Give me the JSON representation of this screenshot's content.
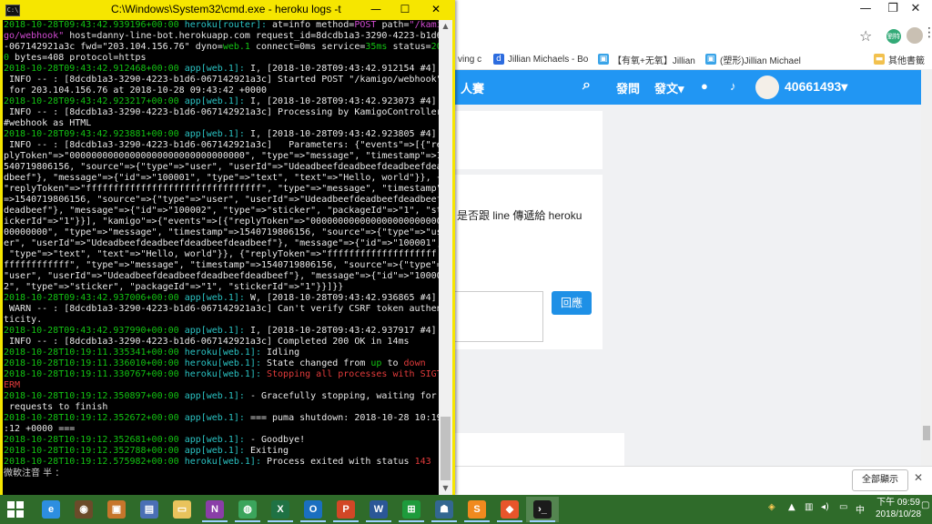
{
  "browser": {
    "bookmarks": [
      {
        "label": "ving c",
        "icon": "generic-page-icon",
        "color": "#888888"
      },
      {
        "label": "Jillian Michaels - Bo",
        "icon": "d-site-icon",
        "color": "#2d6cdf"
      },
      {
        "label": "【有氧+无氧】Jillian",
        "icon": "bilibili-icon",
        "color": "#3aa4e8"
      },
      {
        "label": "(塑形)Jillian Michael",
        "icon": "bilibili-icon",
        "color": "#3aa4e8"
      },
      {
        "label": "其他書籤",
        "icon": "folder-icon",
        "color": "#f2c14e"
      }
    ],
    "ext_badge": "劉特",
    "site": {
      "nav_partial": "人賽",
      "nav_items": [
        "發問",
        "發文"
      ],
      "nav_caret": "▾",
      "username": "40661493",
      "user_caret": "▾",
      "answer_text": "是否跟 line 傳遞給 heroku",
      "reply_button": "回應",
      "show_all": "全部顯示"
    }
  },
  "cmd": {
    "title": "C:\\Windows\\System32\\cmd.exe - heroku  logs -t",
    "lines": [
      [
        [
          "2018-10-28T09:43:42.939196+00:00 ",
          "g"
        ],
        [
          "heroku[router]: ",
          "c"
        ],
        [
          "at=info method=",
          "w"
        ],
        [
          "POST",
          "m"
        ],
        [
          " path=",
          "w"
        ],
        [
          "\"/kami",
          "m"
        ]
      ],
      [
        [
          "go/webhook\"",
          "m"
        ],
        [
          " host=danny-line-bot.herokuapp.com request_id=8dcdb1a3-3290-4223-b1d6",
          "w"
        ]
      ],
      [
        [
          "-067142921a3c fwd=\"203.104.156.76\" dyno=",
          "w"
        ],
        [
          "web.1",
          "g"
        ],
        [
          " connect=0ms service=",
          "w"
        ],
        [
          "35ms",
          "g"
        ],
        [
          " status=",
          "w"
        ],
        [
          "20",
          "g"
        ]
      ],
      [
        [
          "0",
          "g"
        ],
        [
          " bytes=408 protocol=https",
          "w"
        ]
      ],
      [
        [
          "2018-10-28T09:43:42.912468+00:00 ",
          "g"
        ],
        [
          "app[web.1]: ",
          "c"
        ],
        [
          "I, [2018-10-28T09:43:42.912154 #4]",
          "w"
        ]
      ],
      [
        [
          " INFO -- : [8dcdb1a3-3290-4223-b1d6-067142921a3c] Started POST \"/kamigo/webhook\"",
          "w"
        ]
      ],
      [
        [
          " for 203.104.156.76 at 2018-10-28 09:43:42 +0000",
          "w"
        ]
      ],
      [
        [
          "2018-10-28T09:43:42.923217+00:00 ",
          "g"
        ],
        [
          "app[web.1]: ",
          "c"
        ],
        [
          "I, [2018-10-28T09:43:42.923073 #4]",
          "w"
        ]
      ],
      [
        [
          " INFO -- : [8dcdb1a3-3290-4223-b1d6-067142921a3c] Processing by KamigoController",
          "w"
        ]
      ],
      [
        [
          "#webhook as HTML",
          "w"
        ]
      ],
      [
        [
          "2018-10-28T09:43:42.923881+00:00 ",
          "g"
        ],
        [
          "app[web.1]: ",
          "c"
        ],
        [
          "I, [2018-10-28T09:43:42.923805 #4]",
          "w"
        ]
      ],
      [
        [
          " INFO -- : [8dcdb1a3-3290-4223-b1d6-067142921a3c]   Parameters: {\"events\"=>[{\"re",
          "w"
        ]
      ],
      [
        [
          "plyToken\"=>\"00000000000000000000000000000000\", \"type\"=>\"message\", \"timestamp\"=>1",
          "w"
        ]
      ],
      [
        [
          "540719806156, \"source\"=>{\"type\"=>\"user\", \"userId\"=>\"Udeadbeefdeadbeefdeadbeefdea",
          "w"
        ]
      ],
      [
        [
          "dbeef\"}, \"message\"=>{\"id\"=>\"100001\", \"type\"=>\"text\", \"text\"=>\"Hello, world\"}}, {",
          "w"
        ]
      ],
      [
        [
          "\"replyToken\"=>\"ffffffffffffffffffffffffffffffff\", \"type\"=>\"message\", \"timestamp\"",
          "w"
        ]
      ],
      [
        [
          "=>1540719806156, \"source\"=>{\"type\"=>\"user\", \"userId\"=>\"Udeadbeefdeadbeefdeadbeef",
          "w"
        ]
      ],
      [
        [
          "deadbeef\"}, \"message\"=>{\"id\"=>\"100002\", \"type\"=>\"sticker\", \"packageId\"=>\"1\", \"st",
          "w"
        ]
      ],
      [
        [
          "ickerId\"=>\"1\"}}], \"kamigo\"=>{\"events\"=>[{\"replyToken\"=>\"000000000000000000000000",
          "w"
        ]
      ],
      [
        [
          "00000000\", \"type\"=>\"message\", \"timestamp\"=>1540719806156, \"source\"=>{\"type\"=>\"us",
          "w"
        ]
      ],
      [
        [
          "er\", \"userId\"=>\"Udeadbeefdeadbeefdeadbeefdeadbeef\"}, \"message\"=>{\"id\"=>\"100001\",",
          "w"
        ]
      ],
      [
        [
          " \"type\"=>\"text\", \"text\"=>\"Hello, world\"}}, {\"replyToken\"=>\"ffffffffffffffffffff",
          "w"
        ]
      ],
      [
        [
          "ffffffffffff\", \"type\"=>\"message\", \"timestamp\"=>1540719806156, \"source\"=>{\"type\"=>",
          "w"
        ]
      ],
      [
        [
          "\"user\", \"userId\"=>\"Udeadbeefdeadbeefdeadbeefdeadbeef\"}, \"message\"=>{\"id\"=>\"10000",
          "w"
        ]
      ],
      [
        [
          "2\", \"type\"=>\"sticker\", \"packageId\"=>\"1\", \"stickerId\"=>\"1\"}}]}}",
          "w"
        ]
      ],
      [
        [
          "2018-10-28T09:43:42.937006+00:00 ",
          "g"
        ],
        [
          "app[web.1]: ",
          "c"
        ],
        [
          "W, [2018-10-28T09:43:42.936865 #4]",
          "w"
        ]
      ],
      [
        [
          " WARN -- : [8dcdb1a3-3290-4223-b1d6-067142921a3c] Can't verify CSRF token authen",
          "w"
        ]
      ],
      [
        [
          "ticity.",
          "w"
        ]
      ],
      [
        [
          "2018-10-28T09:43:42.937990+00:00 ",
          "g"
        ],
        [
          "app[web.1]: ",
          "c"
        ],
        [
          "I, [2018-10-28T09:43:42.937917 #4]",
          "w"
        ]
      ],
      [
        [
          " INFO -- : [8dcdb1a3-3290-4223-b1d6-067142921a3c] Completed 200 OK in 14ms",
          "w"
        ]
      ],
      [
        [
          "2018-10-28T10:19:11.335341+00:00 ",
          "g"
        ],
        [
          "heroku[web.1]: ",
          "c"
        ],
        [
          "Idling",
          "w"
        ]
      ],
      [
        [
          "2018-10-28T10:19:11.336010+00:00 ",
          "g"
        ],
        [
          "heroku[web.1]: ",
          "c"
        ],
        [
          "State changed from ",
          "w"
        ],
        [
          "up",
          "g"
        ],
        [
          " to ",
          "w"
        ],
        [
          "down",
          "r"
        ]
      ],
      [
        [
          "2018-10-28T10:19:11.330767+00:00 ",
          "g"
        ],
        [
          "heroku[web.1]: ",
          "c"
        ],
        [
          "Stopping all processes with SIGT",
          "r"
        ]
      ],
      [
        [
          "ERM",
          "r"
        ]
      ],
      [
        [
          "2018-10-28T10:19:12.350897+00:00 ",
          "g"
        ],
        [
          "app[web.1]: ",
          "c"
        ],
        [
          "- Gracefully stopping, waiting for",
          "w"
        ]
      ],
      [
        [
          " requests to finish",
          "w"
        ]
      ],
      [
        [
          "2018-10-28T10:19:12.352672+00:00 ",
          "g"
        ],
        [
          "app[web.1]: ",
          "c"
        ],
        [
          "=== puma shutdown: 2018-10-28 10:19",
          "w"
        ]
      ],
      [
        [
          ":12 +0000 ===",
          "w"
        ]
      ],
      [
        [
          "2018-10-28T10:19:12.352681+00:00 ",
          "g"
        ],
        [
          "app[web.1]: ",
          "c"
        ],
        [
          "- Goodbye!",
          "w"
        ]
      ],
      [
        [
          "2018-10-28T10:19:12.352788+00:00 ",
          "g"
        ],
        [
          "app[web.1]: ",
          "c"
        ],
        [
          "Exiting",
          "w"
        ]
      ],
      [
        [
          "2018-10-28T10:19:12.575982+00:00 ",
          "g"
        ],
        [
          "heroku[web.1]: ",
          "c"
        ],
        [
          "Process exited with status ",
          "w"
        ],
        [
          "143",
          "r"
        ]
      ]
    ],
    "ime_status": "微軟注音 半 ："
  },
  "taskbar": {
    "apps": [
      {
        "name": "ie-icon",
        "glyph": "e",
        "color": "#2d8ee0"
      },
      {
        "name": "media-player-icon",
        "glyph": "◉",
        "color": "#6b4b2a"
      },
      {
        "name": "game-icon",
        "glyph": "▣",
        "color": "#c7762b"
      },
      {
        "name": "screen-tool-icon",
        "glyph": "▤",
        "color": "#4a6fb5"
      },
      {
        "name": "file-explorer-icon",
        "glyph": "▭",
        "color": "#e9c35c"
      },
      {
        "name": "onenote-icon",
        "glyph": "N",
        "color": "#8a3ea8"
      },
      {
        "name": "chrome-icon",
        "glyph": "◍",
        "color": "#3ba55c"
      },
      {
        "name": "excel-icon",
        "glyph": "X",
        "color": "#1f7244"
      },
      {
        "name": "outlook-icon",
        "glyph": "O",
        "color": "#1a6fc0"
      },
      {
        "name": "powerpoint-icon",
        "glyph": "P",
        "color": "#d24726"
      },
      {
        "name": "word-icon",
        "glyph": "W",
        "color": "#2b5797"
      },
      {
        "name": "store-icon",
        "glyph": "⊞",
        "color": "#1e9b3c"
      },
      {
        "name": "postgres-icon",
        "glyph": "☗",
        "color": "#336791"
      },
      {
        "name": "sublime-icon",
        "glyph": "S",
        "color": "#f08a1e"
      },
      {
        "name": "git-icon",
        "glyph": "◆",
        "color": "#e8552b"
      },
      {
        "name": "cmd-icon",
        "glyph": "›_",
        "color": "#1b1b1b"
      }
    ],
    "time": "下午 09:59",
    "date": "2018/10/28"
  }
}
